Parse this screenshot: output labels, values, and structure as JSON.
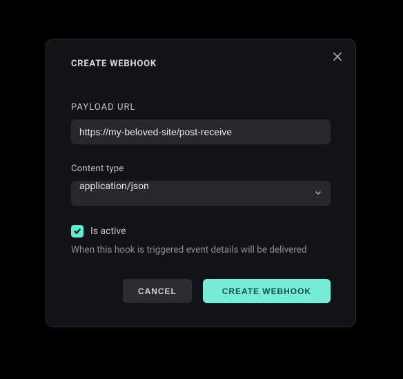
{
  "modal": {
    "title": "CREATE WEBHOOK",
    "payload": {
      "label": "PAYLOAD URL",
      "value": "https://my-beloved-site/post-receive"
    },
    "content_type": {
      "label": "Content type",
      "value": "application/json"
    },
    "active": {
      "checked": true,
      "label": "Is active"
    },
    "helper": "When this hook is triggered event details will be delivered",
    "buttons": {
      "cancel": "CANCEL",
      "submit": "CREATE WEBHOOK"
    }
  },
  "colors": {
    "accent": "#76ecd6",
    "modal_bg": "#121316",
    "input_bg": "#26282d"
  }
}
